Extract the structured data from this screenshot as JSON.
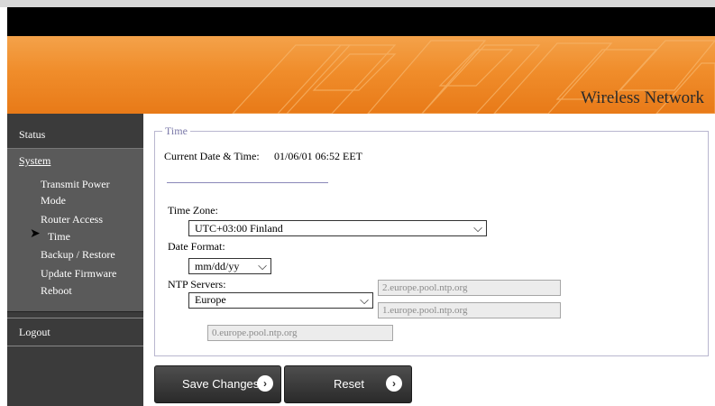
{
  "banner": {
    "title": "Wireless Network"
  },
  "sidebar": {
    "status": "Status",
    "system": "System",
    "items": [
      "Transmit Power",
      "Mode",
      "Router Access",
      "Time",
      "Backup / Restore",
      "Update Firmware",
      "Reboot"
    ],
    "active_item": "Time",
    "logout": "Logout"
  },
  "time_section": {
    "legend": "Time",
    "current_label": "Current Date & Time:",
    "current_value": "01/06/01 06:52 EET",
    "timezone_label": "Time Zone:",
    "timezone_value": "UTC+03:00 Finland",
    "dateformat_label": "Date Format:",
    "dateformat_value": "mm/dd/yy",
    "ntp_label": "NTP Servers:",
    "ntp_region": "Europe",
    "ntp_servers": [
      "2.europe.pool.ntp.org",
      "1.europe.pool.ntp.org",
      "0.europe.pool.ntp.org"
    ]
  },
  "buttons": {
    "save": "Save Changes",
    "reset": "Reset"
  },
  "icons": {
    "active_indicator": "arrow-right-icon",
    "dropdown": "chevron-down-icon",
    "button": "chevron-right-circle-icon"
  },
  "colors": {
    "banner": "#f08d2b",
    "sidebar": "#3b3b3b",
    "legend": "#7a78a8"
  }
}
